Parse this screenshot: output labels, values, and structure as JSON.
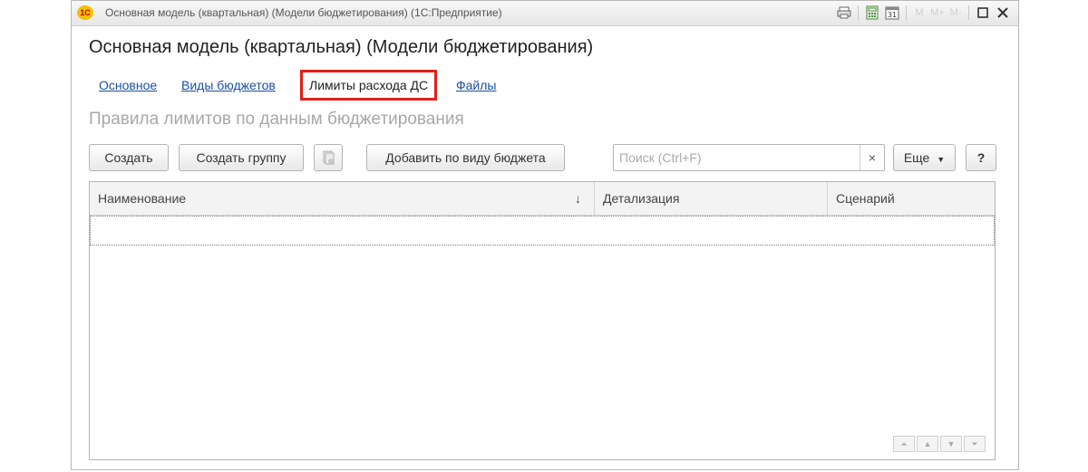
{
  "window": {
    "title": "Основная модель (квартальная) (Модели бюджетирования)  (1С:Предприятие)",
    "logo_text": "1С",
    "toolbar_icons": [
      "print-icon",
      "calculator-icon",
      "calendar-icon",
      "memory-m-icon",
      "memory-m-plus-icon",
      "memory-m-minus-icon",
      "maximize-icon",
      "close-icon"
    ],
    "calendar_day": "31",
    "mem_labels": [
      "M",
      "M+",
      "M-"
    ]
  },
  "form": {
    "title": "Основная модель (квартальная) (Модели бюджетирования)"
  },
  "tabs": [
    {
      "label": "Основное",
      "active": false
    },
    {
      "label": "Виды  бюджетов",
      "active": false
    },
    {
      "label": "Лимиты расхода ДС",
      "active": true
    },
    {
      "label": "Файлы",
      "active": false
    }
  ],
  "section": {
    "title": "Правила лимитов по данным бюджетирования"
  },
  "toolbar": {
    "create_label": "Создать",
    "create_group_label": "Создать группу",
    "add_by_type_label": "Добавить по виду бюджета",
    "more_label": "Еще",
    "help_label": "?"
  },
  "search": {
    "placeholder": "Поиск (Ctrl+F)",
    "value": "",
    "clear_label": "×"
  },
  "table": {
    "columns": [
      "Наименование",
      "Детализация",
      "Сценарий"
    ],
    "sort_indicator": "↓",
    "rows": []
  },
  "colors": {
    "active_tab_border": "#e0201b",
    "link": "#1a4fa0"
  }
}
